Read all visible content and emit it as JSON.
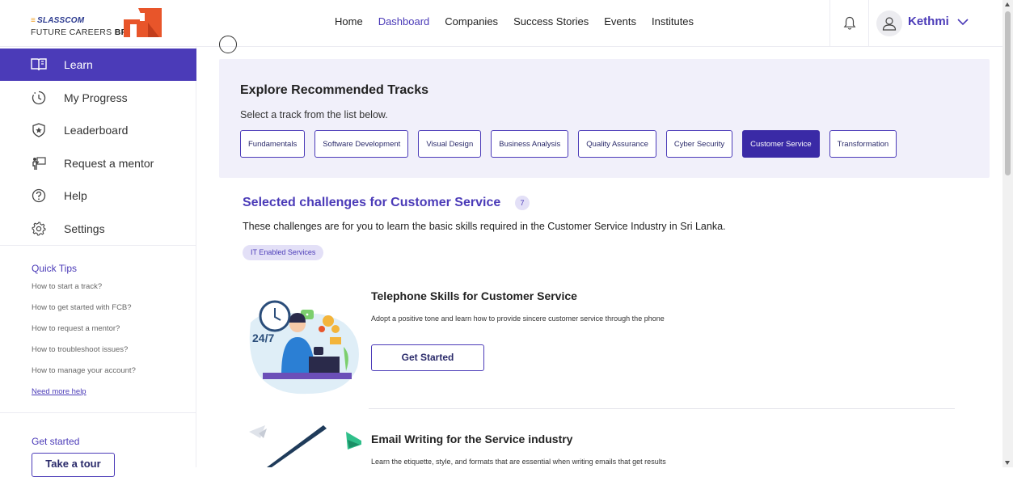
{
  "brand": {
    "top": "SLASSCOM",
    "bottom_light": "FUTURE CAREERS ",
    "bottom_bold": "BRIDGE"
  },
  "nav": {
    "items": [
      "Home",
      "Dashboard",
      "Companies",
      "Success Stories",
      "Events",
      "Institutes"
    ],
    "active": "Dashboard"
  },
  "user": {
    "name": "Kethmi"
  },
  "sidebar": {
    "items": [
      {
        "label": "Learn",
        "icon": "book-icon",
        "active": true
      },
      {
        "label": "My Progress",
        "icon": "progress-icon",
        "active": false
      },
      {
        "label": "Leaderboard",
        "icon": "shield-star-icon",
        "active": false
      },
      {
        "label": "Request a mentor",
        "icon": "mentor-icon",
        "active": false
      },
      {
        "label": "Help",
        "icon": "help-icon",
        "active": false
      },
      {
        "label": "Settings",
        "icon": "gear-icon",
        "active": false
      }
    ],
    "quick_tips_title": "Quick Tips",
    "tips": [
      "How to start a track?",
      "How to get started with FCB?",
      "How to request a mentor?",
      "How to troubleshoot issues?",
      "How to manage your account?"
    ],
    "need_help": "Need more help",
    "get_started_title": "Get started",
    "tour_button": "Take a tour"
  },
  "explore": {
    "title": "Explore Recommended Tracks",
    "subtitle": "Select a track from the list below.",
    "tracks": [
      "Fundamentals",
      "Software Development",
      "Visual Design",
      "Business Analysis",
      "Quality Assurance",
      "Cyber Security",
      "Customer Service",
      "Transformation"
    ],
    "active_track": "Customer Service"
  },
  "challenges": {
    "title": "Selected challenges for Customer Service",
    "count": "7",
    "description": "These challenges are for you to learn the basic skills required in the Customer Service Industry in Sri Lanka.",
    "tag": "IT Enabled Services",
    "cards": [
      {
        "title": "Telephone Skills for Customer Service",
        "description": "Adopt a positive tone and learn how to provide sincere customer service through the phone",
        "button": "Get Started",
        "illustration_text": "24/7"
      },
      {
        "title": "Email Writing for the Service industry",
        "description": "Learn the etiquette, style, and formats that are essential when writing emails that get results"
      }
    ]
  },
  "colors": {
    "accent": "#4b3bb8",
    "active_track": "#3a2aa6",
    "explore_bg": "#f1f0fa",
    "tag_bg": "#e3e0f7",
    "brand_orange": "#e8552a"
  }
}
